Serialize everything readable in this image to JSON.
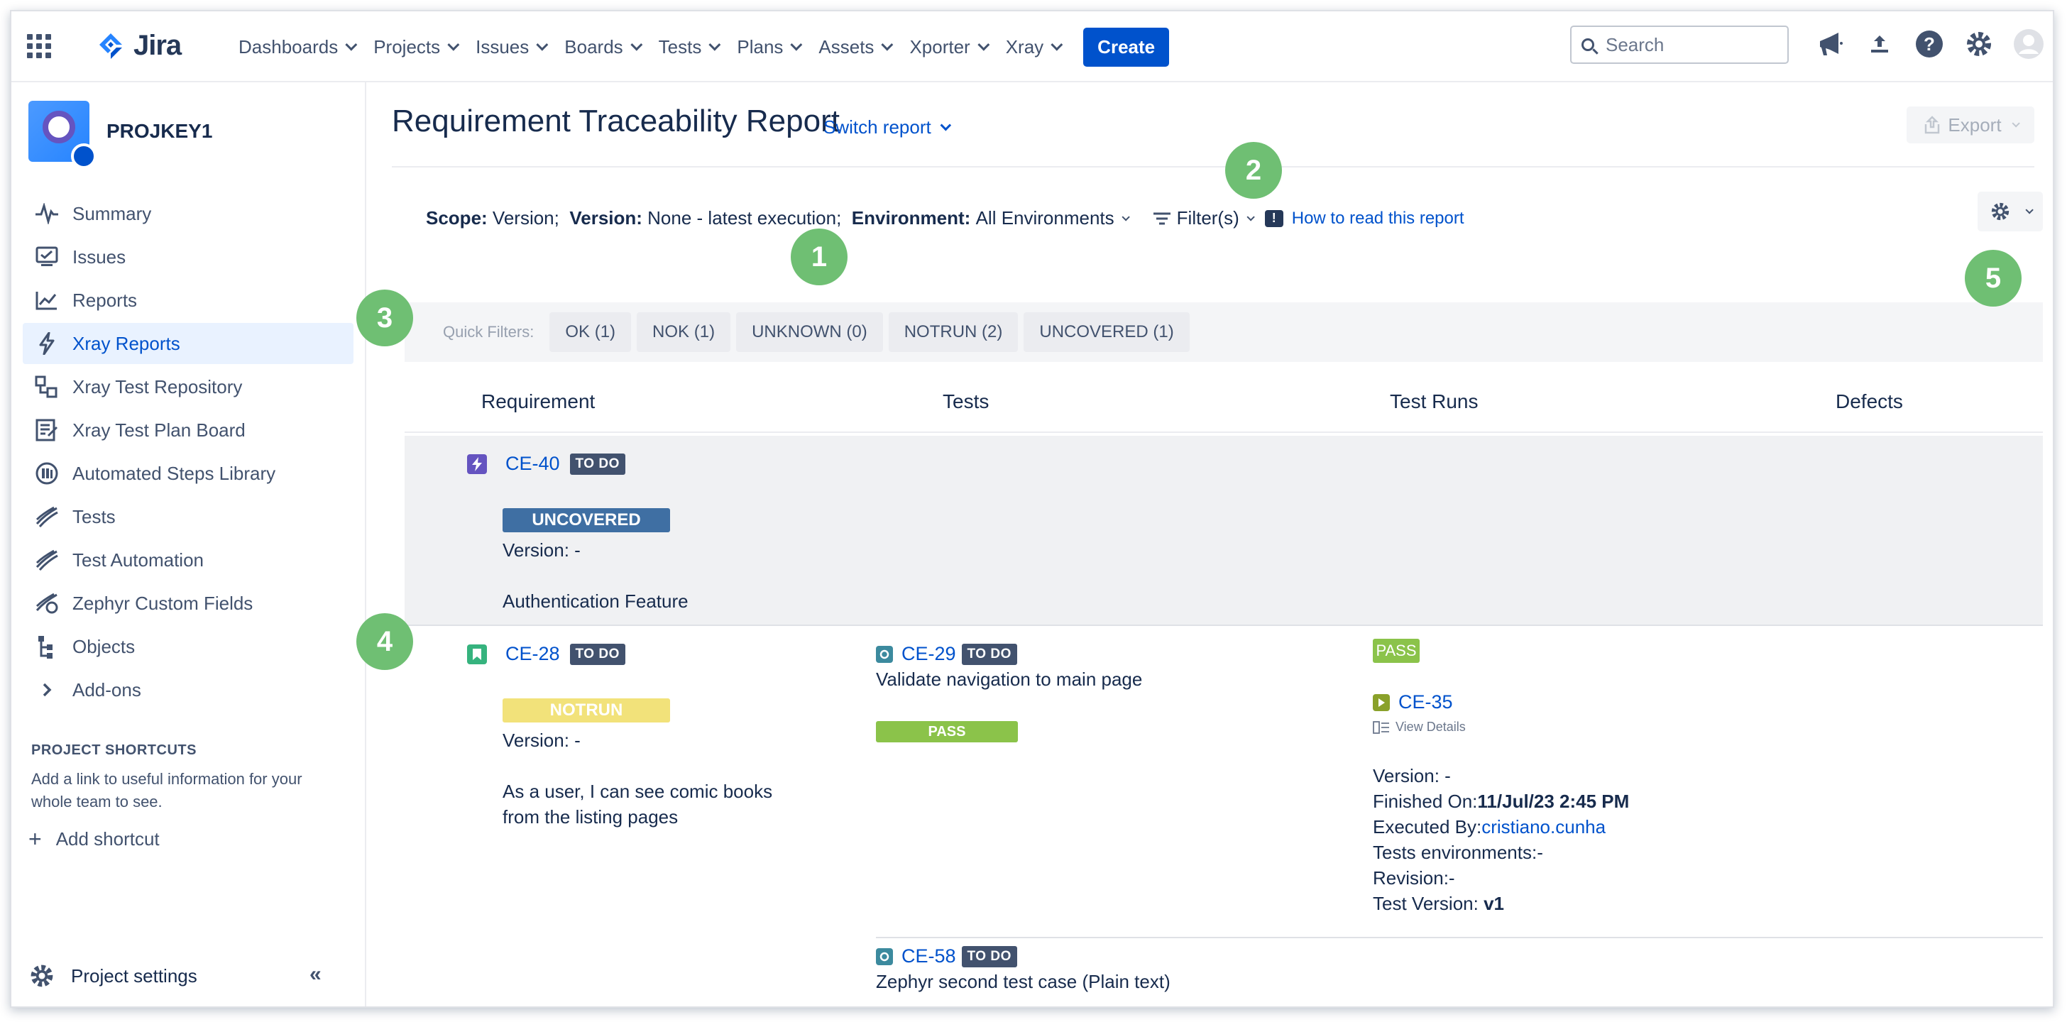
{
  "topnav": {
    "logo_text": "Jira",
    "items": [
      {
        "label": "Dashboards"
      },
      {
        "label": "Projects"
      },
      {
        "label": "Issues"
      },
      {
        "label": "Boards"
      },
      {
        "label": "Tests"
      },
      {
        "label": "Plans"
      },
      {
        "label": "Assets"
      },
      {
        "label": "Xporter"
      },
      {
        "label": "Xray"
      }
    ],
    "create_label": "Create",
    "search_placeholder": "Search",
    "icons": [
      "megaphone-icon",
      "upload-icon",
      "help-icon",
      "settings-icon",
      "user-avatar-icon"
    ]
  },
  "sidebar": {
    "project_name": "PROJKEY1",
    "items": [
      {
        "label": "Summary",
        "icon": "pulse-icon"
      },
      {
        "label": "Issues",
        "icon": "issues-icon"
      },
      {
        "label": "Reports",
        "icon": "reports-icon"
      },
      {
        "label": "Xray Reports",
        "icon": "bolt-icon",
        "active": true
      },
      {
        "label": "Xray Test Repository",
        "icon": "repository-icon"
      },
      {
        "label": "Xray Test Plan Board",
        "icon": "board-icon"
      },
      {
        "label": "Automated Steps Library",
        "icon": "library-icon"
      },
      {
        "label": "Tests",
        "icon": "tests-icon"
      },
      {
        "label": "Test Automation",
        "icon": "automation-icon"
      },
      {
        "label": "Zephyr Custom Fields",
        "icon": "zephyr-icon"
      },
      {
        "label": "Objects",
        "icon": "objects-icon"
      },
      {
        "label": "Add-ons",
        "icon": "chevron-right-icon"
      }
    ],
    "shortcuts_heading": "PROJECT SHORTCUTS",
    "shortcuts_text": "Add a link to useful information for your whole team to see.",
    "add_shortcut": "Add shortcut",
    "project_settings": "Project settings"
  },
  "report": {
    "title": "Requirement Traceability Report",
    "switch_report": "Switch report",
    "export_label": "Export",
    "scope_label": "Scope:",
    "scope_value": "Version;",
    "version_label": "Version:",
    "version_value": "None - latest execution;",
    "environment_label": "Environment:",
    "environment_value": "All Environments",
    "filters_label": "Filter(s)",
    "howto_label": "How to read this report",
    "quick_filters_label": "Quick Filters:",
    "quick_filters": [
      "OK (1)",
      "NOK (1)",
      "UNKNOWN (0)",
      "NOTRUN (2)",
      "UNCOVERED (1)"
    ],
    "columns": [
      "Requirement",
      "Tests",
      "Test Runs",
      "Defects"
    ]
  },
  "rows": [
    {
      "key": "CE-40",
      "status": "TO DO",
      "coverage": "UNCOVERED",
      "version": "Version: -",
      "summary": "Authentication Feature"
    },
    {
      "key": "CE-28",
      "status": "TO DO",
      "coverage": "NOTRUN",
      "version": "Version: -",
      "summary_line1": "As a user, I can see comic books",
      "summary_line2": "from the listing pages",
      "tests": [
        {
          "key": "CE-29",
          "status": "TO DO",
          "summary": "Validate navigation to main page",
          "result": "PASS"
        },
        {
          "key": "CE-58",
          "status": "TO DO",
          "summary": "Zephyr second test case (Plain text)"
        }
      ],
      "run": {
        "result": "PASS",
        "key": "CE-35",
        "view_details": "View Details",
        "version": "Version: -",
        "finished_label": "Finished On:",
        "finished_value": "11/Jul/23 2:45 PM",
        "executed_label": "Executed By:",
        "executed_value": "cristiano.cunha",
        "environments": "Tests environments:-",
        "revision": "Revision:-",
        "test_version_label": "Test Version:",
        "test_version_value": "v1"
      }
    }
  ],
  "callouts": [
    "1",
    "2",
    "3",
    "4",
    "5"
  ],
  "colors": {
    "accent": "#0052cc",
    "callout": "#6fbf73",
    "uncovered": "#3f6fa3",
    "notrun": "#f2e27a",
    "pass": "#8bc34a",
    "lozenge": "#42526e"
  }
}
